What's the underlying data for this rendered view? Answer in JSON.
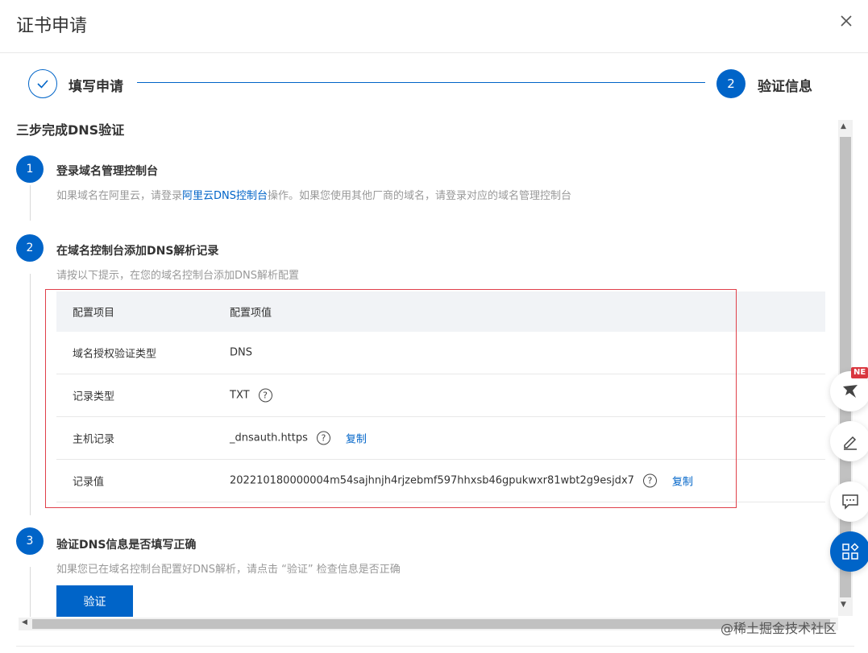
{
  "dialog": {
    "title": "证书申请",
    "close_icon": "close-icon"
  },
  "steps": {
    "step1": {
      "label": "填写申请",
      "state": "done"
    },
    "step2": {
      "label": "验证信息",
      "number": "2",
      "state": "active"
    }
  },
  "section": {
    "title": "三步完成DNS验证"
  },
  "step_one": {
    "number": "1",
    "title": "登录域名管理控制台",
    "desc_prefix": "如果域名在阿里云，请登录",
    "desc_link": "阿里云DNS控制台",
    "desc_suffix": "操作。如果您使用其他厂商的域名，请登录对应的域名管理控制台"
  },
  "step_two": {
    "number": "2",
    "title": "在域名控制台添加DNS解析记录",
    "desc": "请按以下提示，在您的域名控制台添加DNS解析配置"
  },
  "table": {
    "headers": [
      "配置项目",
      "配置项值"
    ],
    "rows": [
      {
        "name": "域名授权验证类型",
        "value": "DNS"
      },
      {
        "name": "记录类型",
        "value": "TXT"
      },
      {
        "name": "主机记录",
        "value": "_dnsauth.https",
        "copy": "复制"
      },
      {
        "name": "记录值",
        "value": "202210180000004m54sajhnjh4rjzebmf597hhxsb46gpukwxr81wbt2g9esjdx7",
        "copy": "复制"
      }
    ],
    "help_glyph": "?"
  },
  "step_three": {
    "number": "3",
    "title": "验证DNS信息是否填写正确",
    "desc": "如果您已在域名控制台配置好DNS解析，请点击 “验证” 检查信息是否正确",
    "button": "验证"
  },
  "watermark": "@稀土掘金技术社区",
  "float_tools": {
    "badge": "NE",
    "icons": [
      "bird-icon",
      "edit-icon",
      "chat-icon",
      "apps-icon"
    ]
  },
  "colors": {
    "accent": "#0064c8",
    "highlight_border": "#e0404a"
  }
}
